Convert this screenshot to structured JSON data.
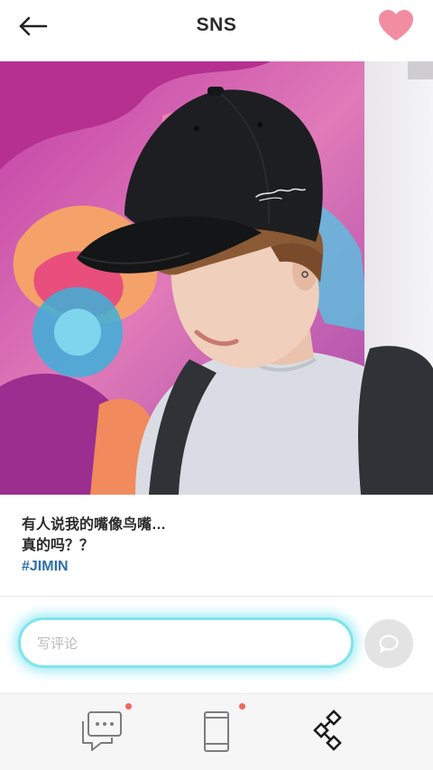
{
  "header": {
    "title": "SNS",
    "back_icon": "arrow-left-icon",
    "favorite_icon": "heart-icon",
    "favorite_color": "#f28ca0"
  },
  "post": {
    "caption_line1": "有人说我的嘴像鸟嘴…",
    "caption_line2": "真的吗？？",
    "hashtag": "#JIMIN",
    "hashtag_color": "#2d6fa8"
  },
  "comment": {
    "placeholder": "写评论",
    "value": "",
    "send_icon": "chat-bubble-icon",
    "glow_color": "#7fe3ee"
  },
  "bottom_nav": {
    "items": [
      {
        "icon": "message-icon",
        "has_badge": true
      },
      {
        "icon": "phone-icon",
        "has_badge": true
      },
      {
        "icon": "share-network-icon",
        "has_badge": false
      }
    ],
    "badge_color": "#f0675b"
  }
}
